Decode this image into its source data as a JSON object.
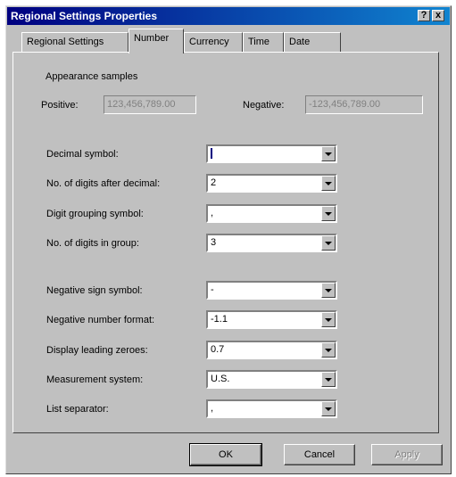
{
  "window": {
    "title": "Regional Settings Properties",
    "help_btn": "?",
    "close_btn": "x"
  },
  "tabs": [
    {
      "label": "Regional Settings"
    },
    {
      "label": "Number"
    },
    {
      "label": "Currency"
    },
    {
      "label": "Time"
    },
    {
      "label": "Date"
    }
  ],
  "appearance": {
    "group_label": "Appearance samples",
    "positive_label": "Positive:",
    "positive_value": "123,456,789.00",
    "negative_label": "Negative:",
    "negative_value": "-123,456,789.00"
  },
  "fields": [
    {
      "label": "Decimal symbol:",
      "value": ""
    },
    {
      "label": "No. of digits after decimal:",
      "value": "2"
    },
    {
      "label": "Digit grouping symbol:",
      "value": ","
    },
    {
      "label": "No. of digits in group:",
      "value": "3"
    },
    {
      "label": "Negative sign symbol:",
      "value": "-"
    },
    {
      "label": "Negative number format:",
      "value": "-1.1"
    },
    {
      "label": "Display leading zeroes:",
      "value": "0.7"
    },
    {
      "label": "Measurement system:",
      "value": "U.S."
    },
    {
      "label": "List separator:",
      "value": ","
    }
  ],
  "buttons": {
    "ok": "OK",
    "cancel": "Cancel",
    "apply": "Apply"
  }
}
